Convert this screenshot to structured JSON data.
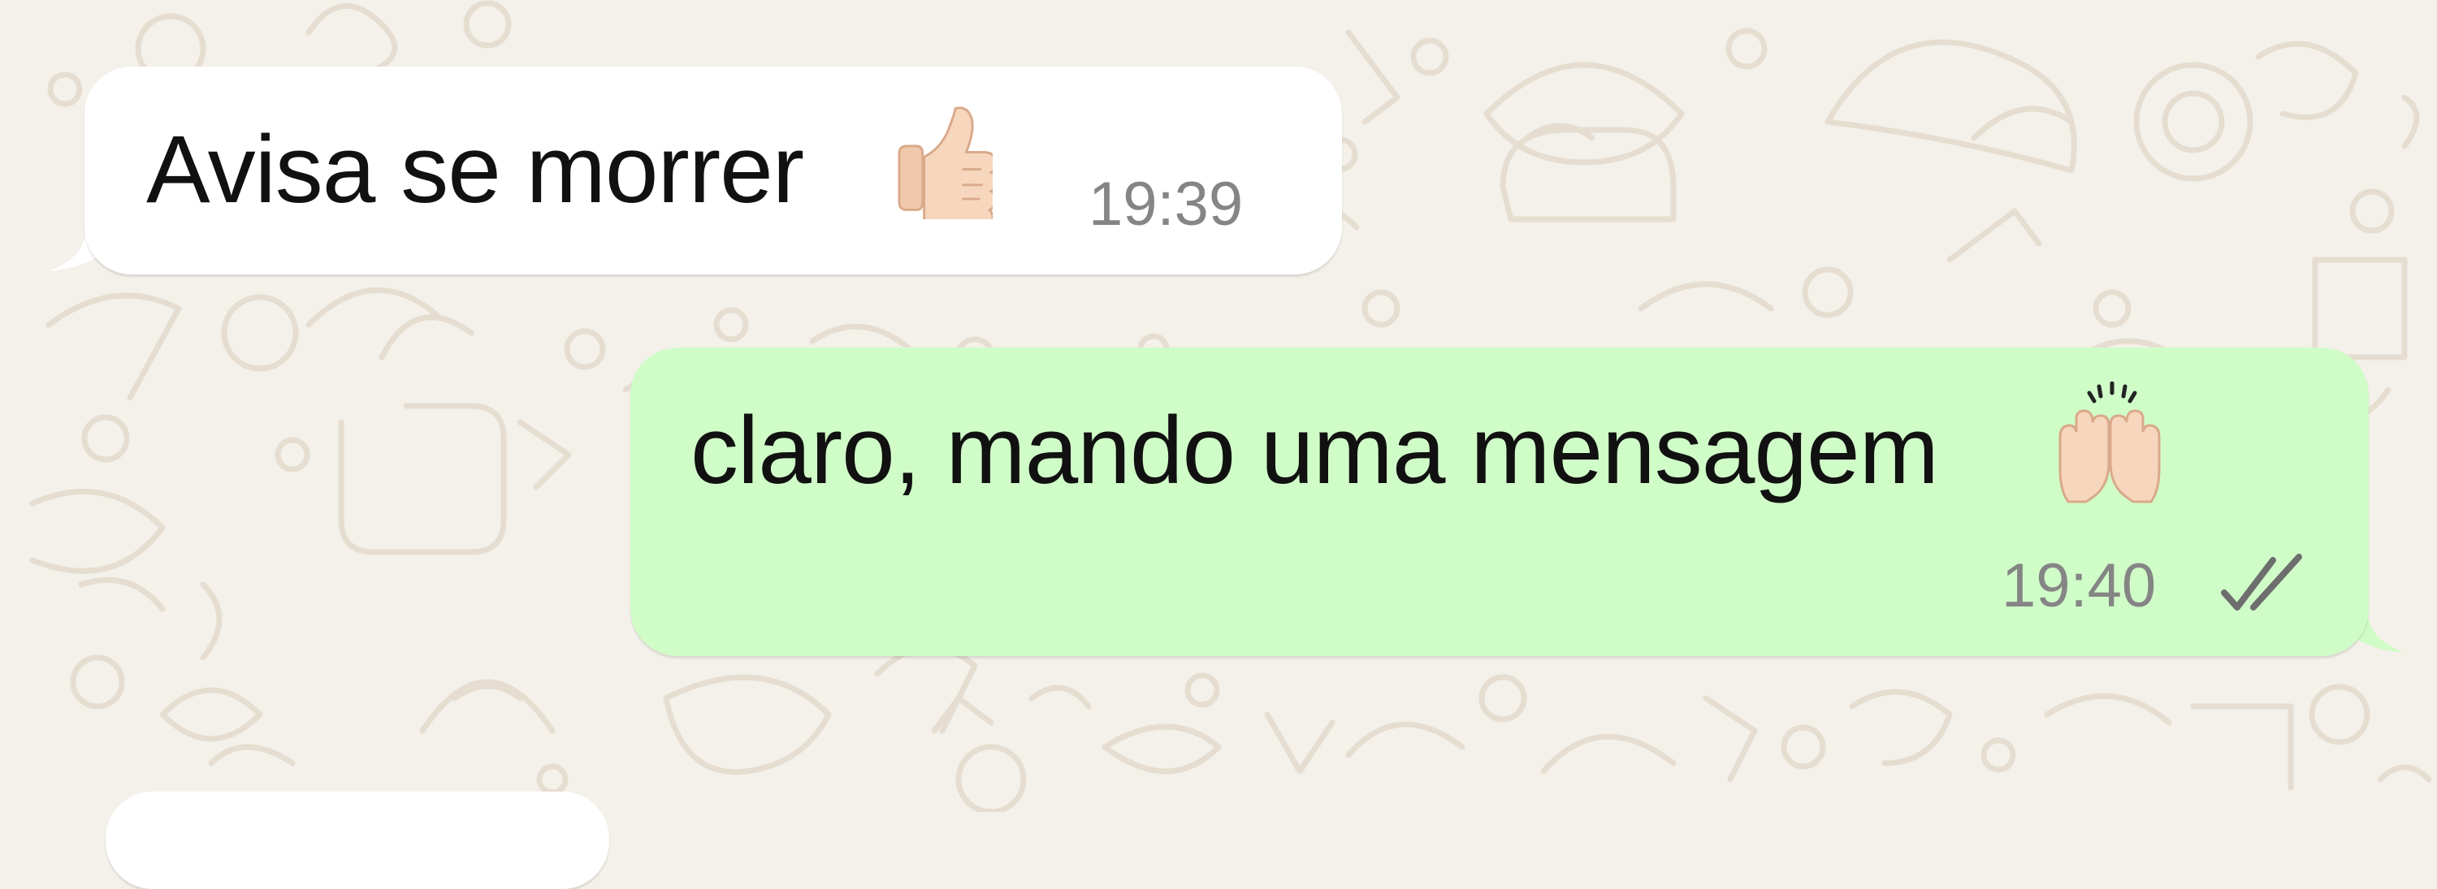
{
  "chat": {
    "messages": [
      {
        "direction": "incoming",
        "text": "Avisa se morrer",
        "emoji": "thumbs-up-icon",
        "time": "19:39"
      },
      {
        "direction": "outgoing",
        "text": "claro, mando uma mensagem",
        "emoji": "raising-hands-icon",
        "time": "19:40",
        "status": "double-check-icon"
      }
    ]
  },
  "colors": {
    "wallpaper": "#f4f0ea",
    "wallpaper_doodle": "#e6ddd1",
    "incoming_bubble": "#ffffff",
    "outgoing_bubble": "#d0fcc8",
    "message_text": "#111111",
    "timestamp": "#858585",
    "skin_tone": "#f4cfb3"
  }
}
